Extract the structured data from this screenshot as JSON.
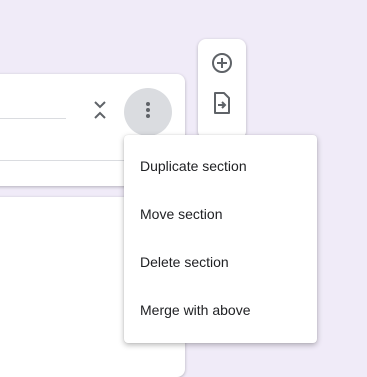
{
  "section_card": {
    "collapse_icon": "unfold-less-icon",
    "more_icon": "more-vert-icon"
  },
  "side_toolbar": {
    "items": [
      {
        "icon": "add-circle-icon",
        "label": "Add question"
      },
      {
        "icon": "import-file-icon",
        "label": "Import questions"
      }
    ]
  },
  "context_menu": {
    "items": [
      {
        "label": "Duplicate section"
      },
      {
        "label": "Move section"
      },
      {
        "label": "Delete section"
      },
      {
        "label": "Merge with above"
      }
    ]
  },
  "colors": {
    "background": "#f0ebf8",
    "card": "#ffffff",
    "active_button": "#dadce0",
    "text": "#202124",
    "icon": "#5f6368"
  }
}
